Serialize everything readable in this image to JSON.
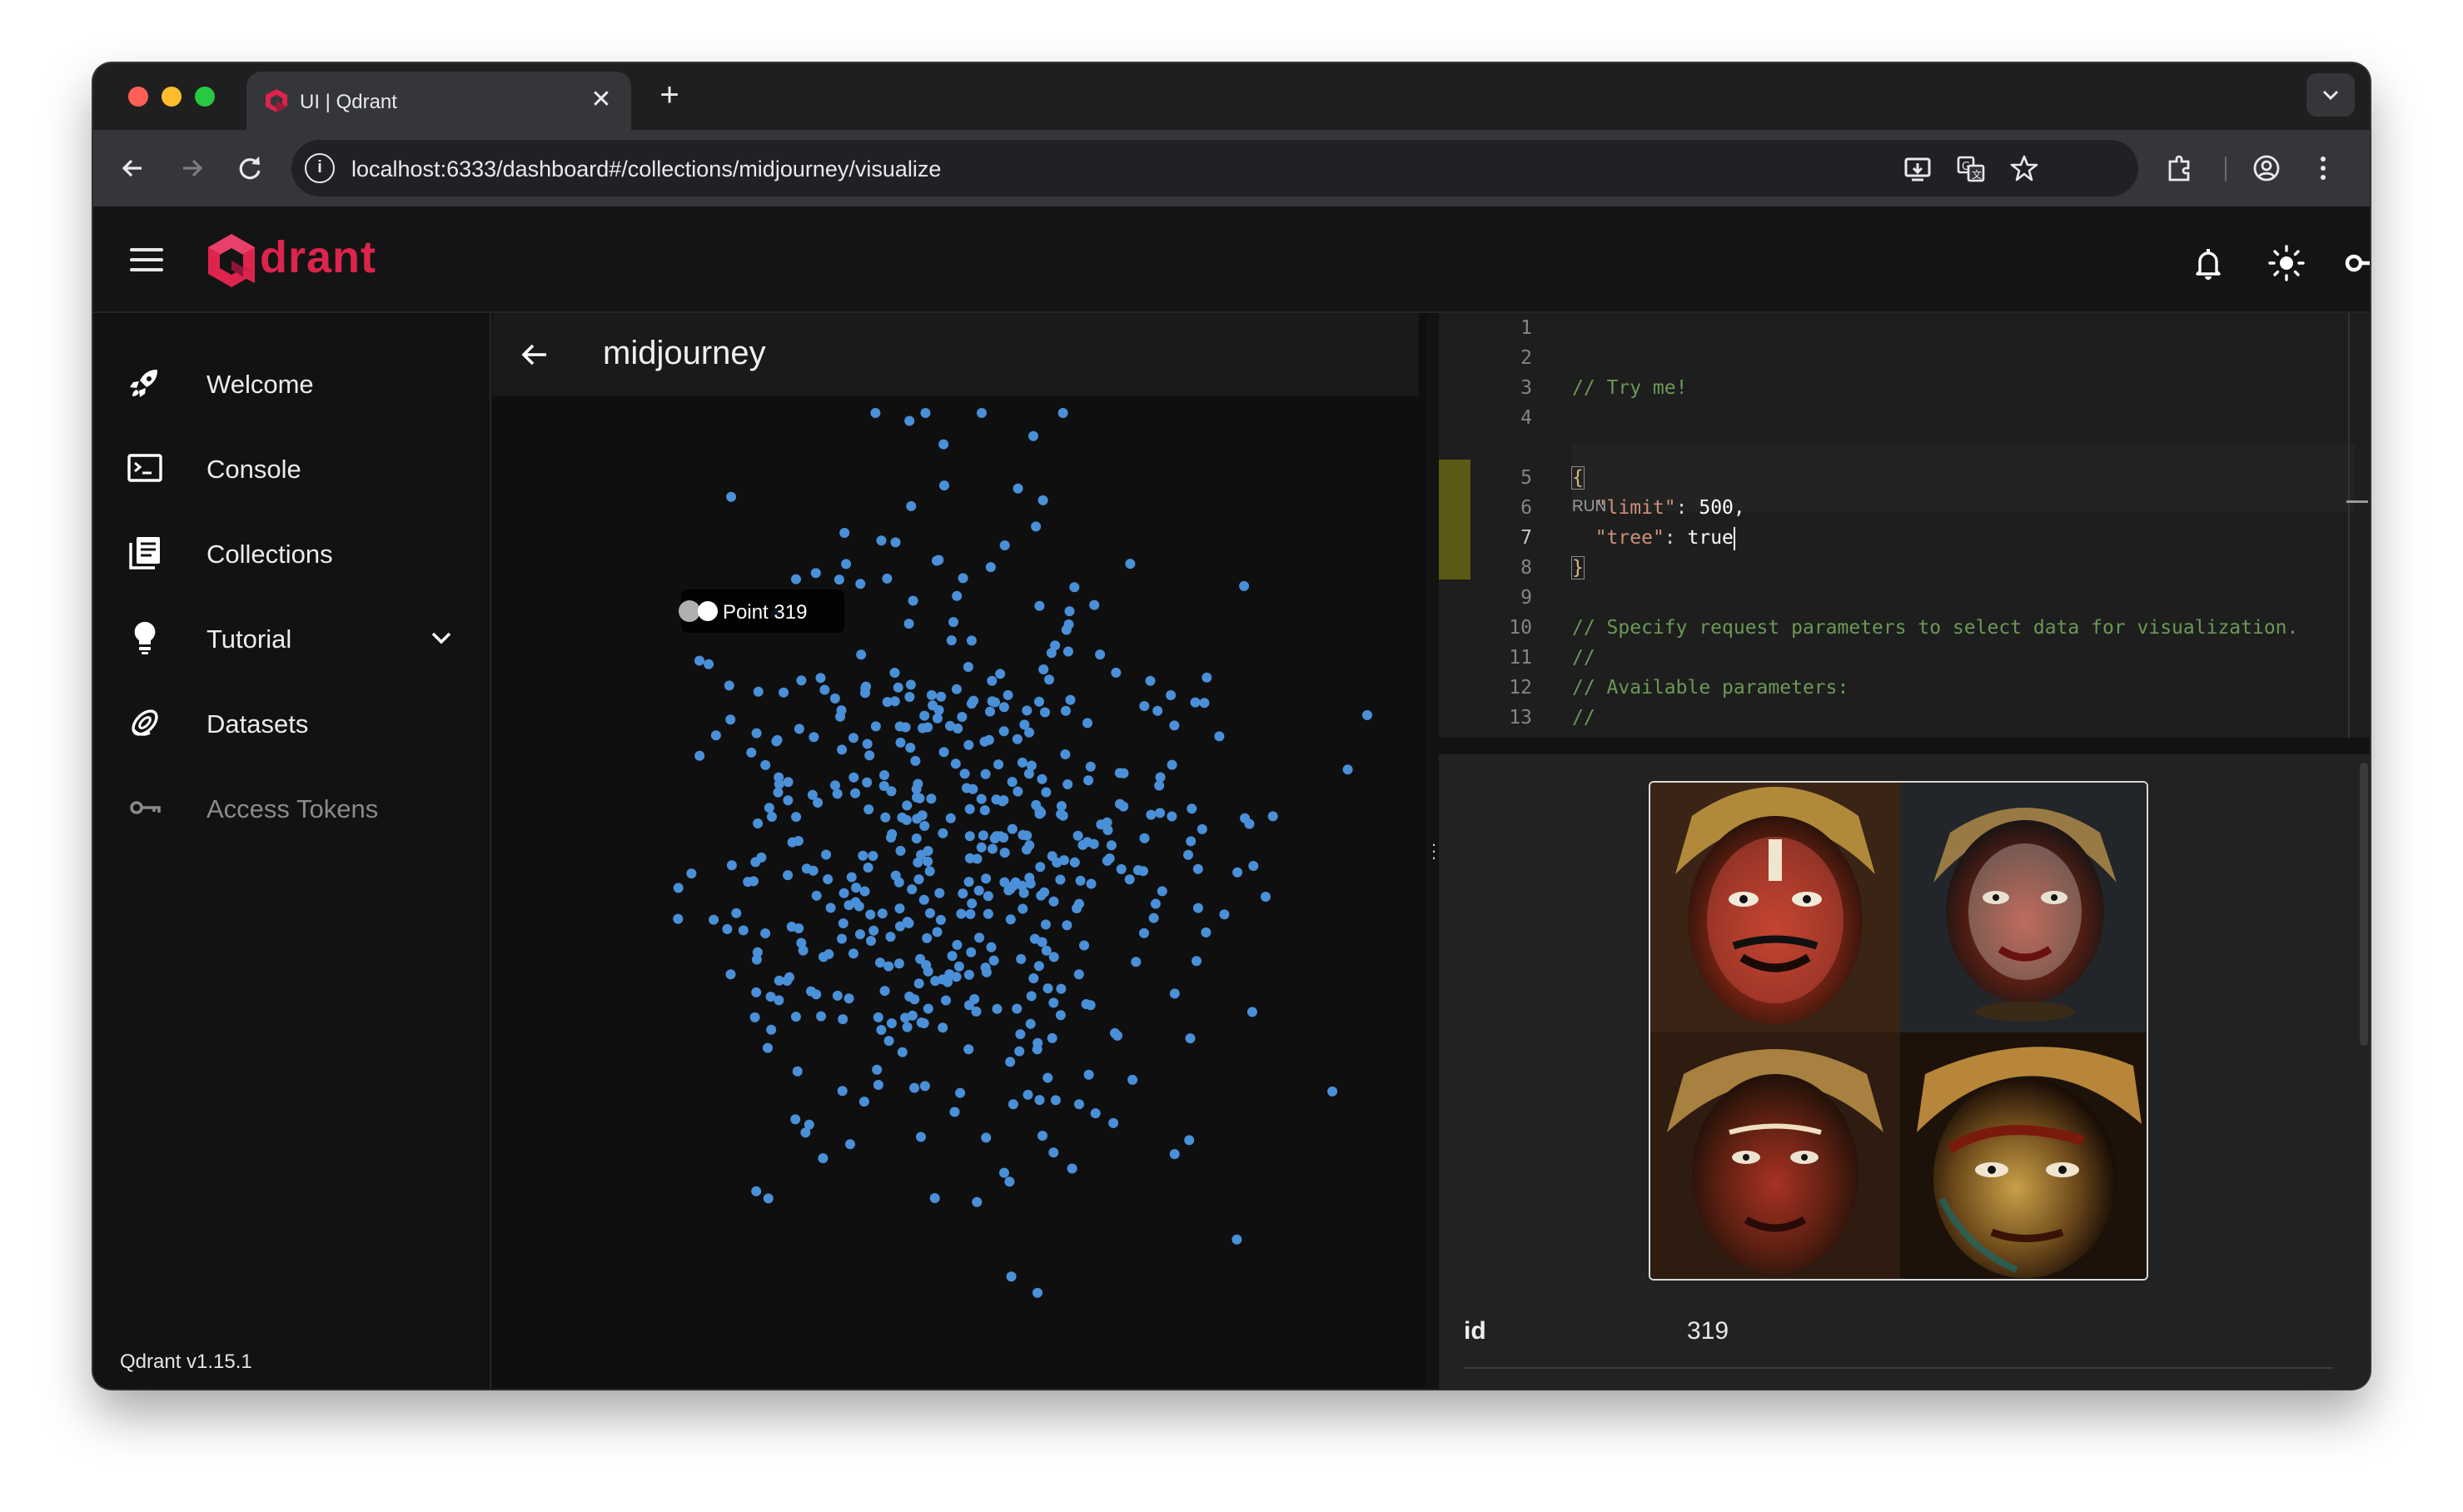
{
  "browser": {
    "tab_title": "UI | Qdrant",
    "tab_close": "✕",
    "new_tab": "+",
    "url": "localhost:6333/dashboard#/collections/midjourney/visualize"
  },
  "app": {
    "logo_text": "drant",
    "version": "Qdrant v1.15.1",
    "brand_color": "#dc244c"
  },
  "sidebar": {
    "items": [
      {
        "label": "Welcome",
        "icon": "rocket-icon"
      },
      {
        "label": "Console",
        "icon": "terminal-icon"
      },
      {
        "label": "Collections",
        "icon": "collections-icon"
      },
      {
        "label": "Tutorial",
        "icon": "lightbulb-icon"
      },
      {
        "label": "Datasets",
        "icon": "datasets-icon"
      },
      {
        "label": "Access Tokens",
        "icon": "key-icon"
      }
    ]
  },
  "main": {
    "collection_title": "midjourney",
    "tooltip": "Point 319",
    "point_color": "#4a90d9"
  },
  "editor": {
    "lines": [
      {
        "n": "1",
        "text": ""
      },
      {
        "n": "2",
        "text": ""
      },
      {
        "n": "3",
        "text": "// Try me!"
      },
      {
        "n": "4",
        "text": ""
      },
      {
        "n": "5",
        "text": "{"
      },
      {
        "n": "6",
        "key": "\"limit\"",
        "value": "500,"
      },
      {
        "n": "7",
        "key": "\"tree\"",
        "value": "true"
      },
      {
        "n": "8",
        "text": "}"
      },
      {
        "n": "9",
        "text": ""
      },
      {
        "n": "10",
        "text": "// Specify request parameters to select data for visualization."
      },
      {
        "n": "11",
        "text": "//"
      },
      {
        "n": "12",
        "text": "// Available parameters:"
      },
      {
        "n": "13",
        "text": "//"
      }
    ],
    "run_lens": "RUN"
  },
  "detail": {
    "id_label": "id",
    "id_value": "319"
  }
}
